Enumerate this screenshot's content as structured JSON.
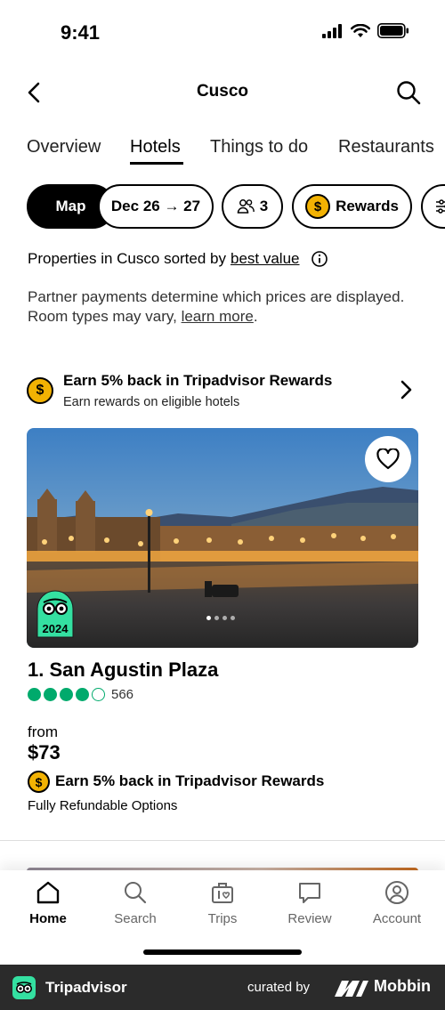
{
  "status_bar": {
    "time": "9:41"
  },
  "topbar": {
    "title": "Cusco"
  },
  "tabs": [
    {
      "label": "Overview",
      "active": false
    },
    {
      "label": "Hotels",
      "active": true
    },
    {
      "label": "Things to do",
      "active": false
    },
    {
      "label": "Restaurants",
      "active": false
    }
  ],
  "chips": {
    "map": "Map",
    "dates": "Dec 26 → 27",
    "guests": "3",
    "rewards": "Rewards"
  },
  "sort": {
    "prefix": "Properties in Cusco sorted by",
    "link": "best value"
  },
  "disclaimer": {
    "text": "Partner payments determine which prices are displayed. Room types may vary,",
    "link": "learn more",
    "suffix": "."
  },
  "rewards_banner": {
    "title": "Earn 5% back in Tripadvisor Rewards",
    "subtitle": "Earn rewards on eligible hotels"
  },
  "coin_symbol": "$",
  "hotel": {
    "name": "1. San Agustin Plaza",
    "rating": 4,
    "rating_max": 5,
    "review_count": "566",
    "award_year": "2024",
    "from_label": "from",
    "price": "$73",
    "reward_text": "Earn 5% back in Tripadvisor Rewards",
    "refund": "Fully Refundable Options",
    "photo_index": 1,
    "photo_count": 4
  },
  "bottom_nav": [
    {
      "label": "Home",
      "icon": "home-icon",
      "active": true
    },
    {
      "label": "Search",
      "icon": "search-icon",
      "active": false
    },
    {
      "label": "Trips",
      "icon": "trips-icon",
      "active": false
    },
    {
      "label": "Review",
      "icon": "review-icon",
      "active": false
    },
    {
      "label": "Account",
      "icon": "account-icon",
      "active": false
    }
  ],
  "footer": {
    "brand": "Tripadvisor",
    "curated": "curated by",
    "mobbin": "Mobbin"
  },
  "colors": {
    "accent_green": "#00aa6c",
    "coin_gold": "#f2b203",
    "footer_bg": "#2b2b2b"
  }
}
